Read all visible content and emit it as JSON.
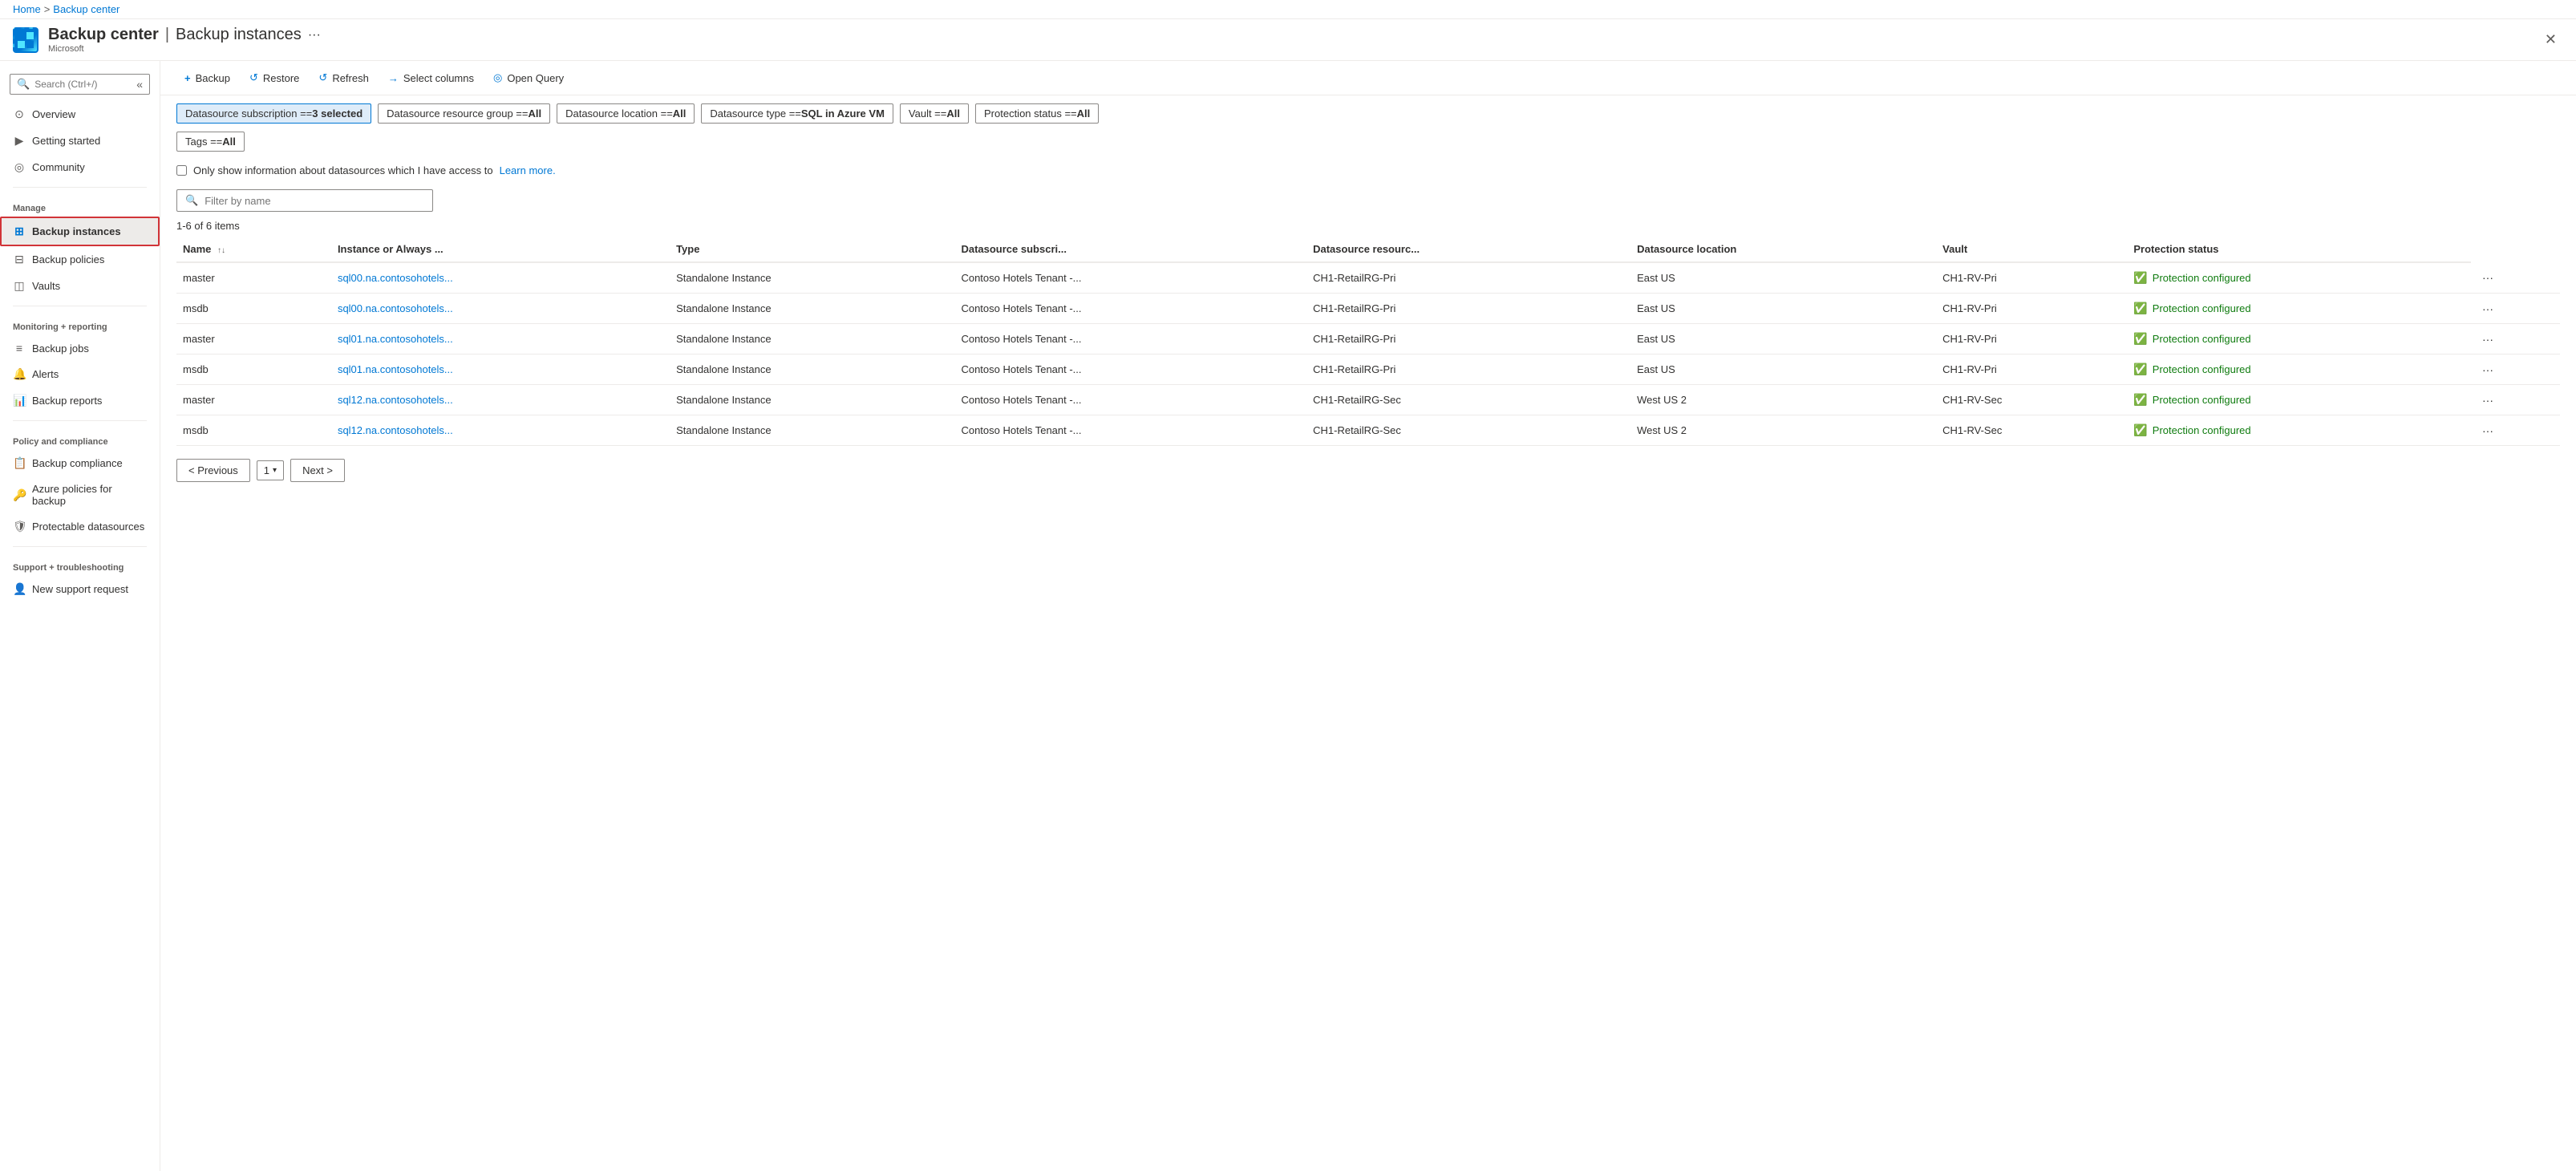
{
  "breadcrumb": {
    "home": "Home",
    "separator": ">",
    "current": "Backup center"
  },
  "header": {
    "app_name": "Backup center",
    "separator": "|",
    "page_name": "Backup instances",
    "more_label": "···",
    "subtitle": "Microsoft",
    "close_label": "✕"
  },
  "sidebar": {
    "search_placeholder": "Search (Ctrl+/)",
    "collapse_icon": "«",
    "items": [
      {
        "id": "overview",
        "label": "Overview",
        "icon": "⊙",
        "section": null
      },
      {
        "id": "getting-started",
        "label": "Getting started",
        "icon": "▶",
        "section": null
      },
      {
        "id": "community",
        "label": "Community",
        "icon": "◎",
        "section": null
      },
      {
        "id": "backup-instances",
        "label": "Backup instances",
        "icon": "⊞",
        "section": "Manage",
        "active": true
      },
      {
        "id": "backup-policies",
        "label": "Backup policies",
        "icon": "⊟",
        "section": null
      },
      {
        "id": "vaults",
        "label": "Vaults",
        "icon": "◫",
        "section": null
      },
      {
        "id": "backup-jobs",
        "label": "Backup jobs",
        "icon": "≡",
        "section": "Monitoring + reporting"
      },
      {
        "id": "alerts",
        "label": "Alerts",
        "icon": "🔔",
        "section": null
      },
      {
        "id": "backup-reports",
        "label": "Backup reports",
        "icon": "📊",
        "section": null
      },
      {
        "id": "backup-compliance",
        "label": "Backup compliance",
        "icon": "📋",
        "section": "Policy and compliance"
      },
      {
        "id": "azure-policies",
        "label": "Azure policies for backup",
        "icon": "🔑",
        "section": null
      },
      {
        "id": "protectable-datasources",
        "label": "Protectable datasources",
        "icon": "🛡",
        "section": null
      },
      {
        "id": "new-support-request",
        "label": "New support request",
        "icon": "👤",
        "section": "Support + troubleshooting"
      }
    ]
  },
  "toolbar": {
    "backup_label": "+ Backup",
    "restore_label": "↺ Restore",
    "refresh_label": "↺ Refresh",
    "select_columns_label": "→ Select columns",
    "open_query_label": "◎ Open Query"
  },
  "filters": {
    "datasource_subscription": {
      "label": "Datasource subscription == ",
      "value": "3 selected",
      "active": true
    },
    "datasource_resource_group": {
      "label": "Datasource resource group == ",
      "value": "All"
    },
    "datasource_location": {
      "label": "Datasource location == ",
      "value": "All"
    },
    "datasource_type": {
      "label": "Datasource type == ",
      "value": "SQL in Azure VM"
    },
    "vault": {
      "label": "Vault == ",
      "value": "All"
    },
    "protection_status": {
      "label": "Protection status == ",
      "value": "All"
    },
    "tags": {
      "label": "Tags == ",
      "value": "All"
    }
  },
  "checkbox_row": {
    "label": "Only show information about datasources which I have access to",
    "link_text": "Learn more.",
    "link_href": "#"
  },
  "filter_input": {
    "placeholder": "Filter by name"
  },
  "count_text": "1-6 of 6 items",
  "table": {
    "columns": [
      {
        "id": "name",
        "label": "Name",
        "sortable": true
      },
      {
        "id": "instance",
        "label": "Instance or Always ...",
        "sortable": false
      },
      {
        "id": "type",
        "label": "Type",
        "sortable": false
      },
      {
        "id": "datasource_subscription",
        "label": "Datasource subscri...",
        "sortable": false
      },
      {
        "id": "datasource_resource",
        "label": "Datasource resourc...",
        "sortable": false
      },
      {
        "id": "datasource_location",
        "label": "Datasource location",
        "sortable": false
      },
      {
        "id": "vault",
        "label": "Vault",
        "sortable": false
      },
      {
        "id": "protection_status",
        "label": "Protection status",
        "sortable": false
      }
    ],
    "rows": [
      {
        "name": "master",
        "instance": "sql00.na.contosohotels...",
        "type": "Standalone Instance",
        "datasource_subscription": "Contoso Hotels Tenant -...",
        "datasource_resource": "CH1-RetailRG-Pri",
        "datasource_location": "East US",
        "vault": "CH1-RV-Pri",
        "protection_status": "Protection configured"
      },
      {
        "name": "msdb",
        "instance": "sql00.na.contosohotels...",
        "type": "Standalone Instance",
        "datasource_subscription": "Contoso Hotels Tenant -...",
        "datasource_resource": "CH1-RetailRG-Pri",
        "datasource_location": "East US",
        "vault": "CH1-RV-Pri",
        "protection_status": "Protection configured"
      },
      {
        "name": "master",
        "instance": "sql01.na.contosohotels...",
        "type": "Standalone Instance",
        "datasource_subscription": "Contoso Hotels Tenant -...",
        "datasource_resource": "CH1-RetailRG-Pri",
        "datasource_location": "East US",
        "vault": "CH1-RV-Pri",
        "protection_status": "Protection configured"
      },
      {
        "name": "msdb",
        "instance": "sql01.na.contosohotels...",
        "type": "Standalone Instance",
        "datasource_subscription": "Contoso Hotels Tenant -...",
        "datasource_resource": "CH1-RetailRG-Pri",
        "datasource_location": "East US",
        "vault": "CH1-RV-Pri",
        "protection_status": "Protection configured"
      },
      {
        "name": "master",
        "instance": "sql12.na.contosohotels...",
        "type": "Standalone Instance",
        "datasource_subscription": "Contoso Hotels Tenant -...",
        "datasource_resource": "CH1-RetailRG-Sec",
        "datasource_location": "West US 2",
        "vault": "CH1-RV-Sec",
        "protection_status": "Protection configured"
      },
      {
        "name": "msdb",
        "instance": "sql12.na.contosohotels...",
        "type": "Standalone Instance",
        "datasource_subscription": "Contoso Hotels Tenant -...",
        "datasource_resource": "CH1-RetailRG-Sec",
        "datasource_location": "West US 2",
        "vault": "CH1-RV-Sec",
        "protection_status": "Protection configured"
      }
    ]
  },
  "pagination": {
    "previous_label": "< Previous",
    "next_label": "Next >",
    "current_page": "1"
  }
}
